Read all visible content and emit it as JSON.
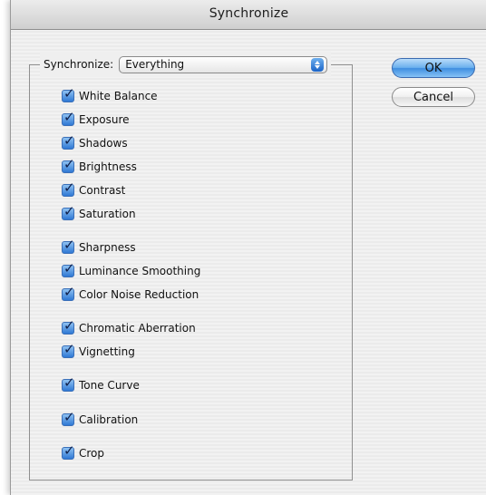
{
  "window": {
    "title": "Synchronize"
  },
  "group": {
    "label": "Synchronize:",
    "select_value": "Everything"
  },
  "items": [
    {
      "label": "White Balance",
      "checked": true
    },
    {
      "label": "Exposure",
      "checked": true
    },
    {
      "label": "Shadows",
      "checked": true
    },
    {
      "label": "Brightness",
      "checked": true
    },
    {
      "label": "Contrast",
      "checked": true
    },
    {
      "label": "Saturation",
      "checked": true
    },
    {
      "label": "Sharpness",
      "checked": true
    },
    {
      "label": "Luminance Smoothing",
      "checked": true
    },
    {
      "label": "Color Noise Reduction",
      "checked": true
    },
    {
      "label": "Chromatic Aberration",
      "checked": true
    },
    {
      "label": "Vignetting",
      "checked": true
    },
    {
      "label": "Tone Curve",
      "checked": true
    },
    {
      "label": "Calibration",
      "checked": true
    },
    {
      "label": "Crop",
      "checked": true
    }
  ],
  "buttons": {
    "ok": "OK",
    "cancel": "Cancel"
  },
  "colors": {
    "accent": "#3f8ee0",
    "checkbox": "#2f78d4"
  },
  "icons": {
    "select_arrow": "updown-arrows-icon",
    "check": "checkmark-icon"
  }
}
